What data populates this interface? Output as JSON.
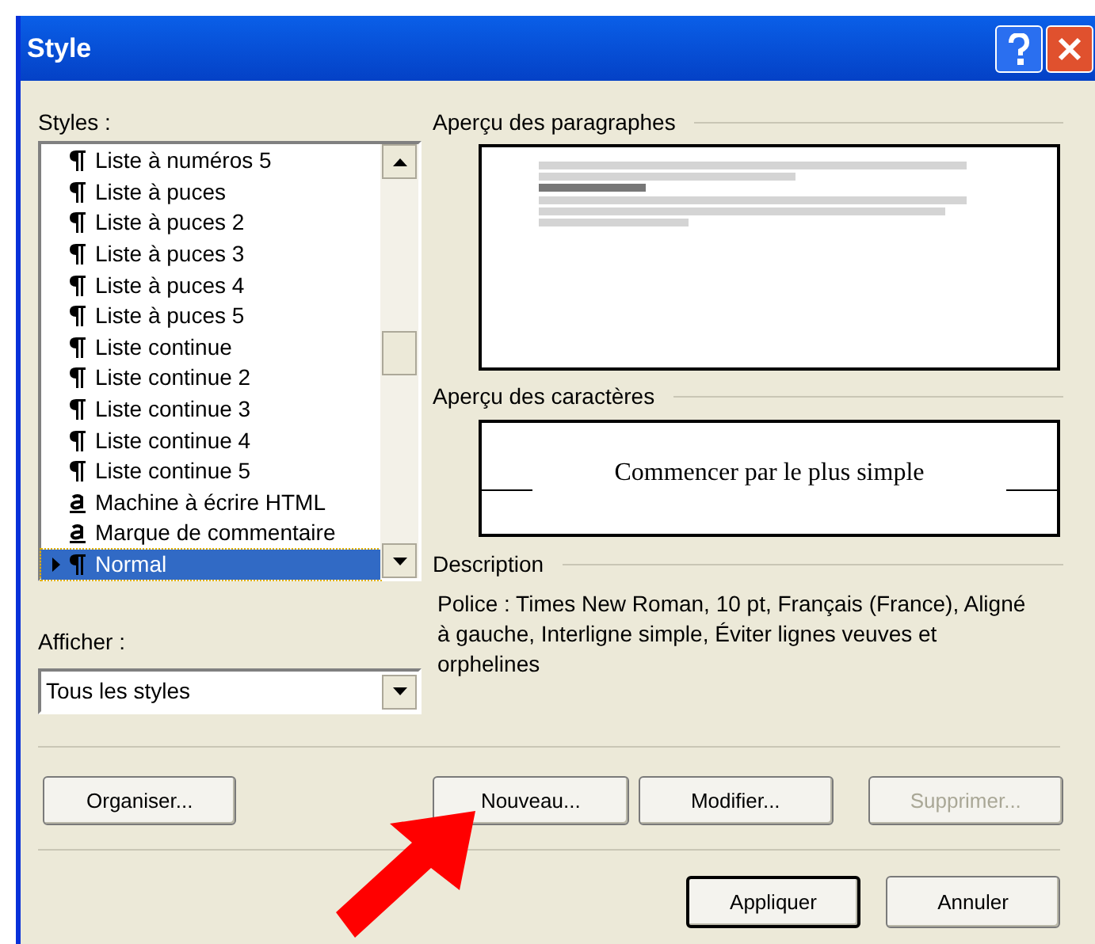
{
  "window": {
    "title": "Style"
  },
  "styles_label": "Styles :",
  "styles": [
    {
      "label": "Liste à numéros 5",
      "kind": "paragraph",
      "selected": false
    },
    {
      "label": "Liste à puces",
      "kind": "paragraph",
      "selected": false
    },
    {
      "label": "Liste à puces 2",
      "kind": "paragraph",
      "selected": false
    },
    {
      "label": "Liste à puces 3",
      "kind": "paragraph",
      "selected": false
    },
    {
      "label": "Liste à puces 4",
      "kind": "paragraph",
      "selected": false
    },
    {
      "label": "Liste à puces 5",
      "kind": "paragraph",
      "selected": false
    },
    {
      "label": "Liste continue",
      "kind": "paragraph",
      "selected": false
    },
    {
      "label": "Liste continue 2",
      "kind": "paragraph",
      "selected": false
    },
    {
      "label": "Liste continue 3",
      "kind": "paragraph",
      "selected": false
    },
    {
      "label": "Liste continue 4",
      "kind": "paragraph",
      "selected": false
    },
    {
      "label": "Liste continue 5",
      "kind": "paragraph",
      "selected": false
    },
    {
      "label": "Machine à écrire HTML",
      "kind": "character",
      "selected": false
    },
    {
      "label": "Marque de commentaire",
      "kind": "character",
      "selected": false
    },
    {
      "label": "Normal",
      "kind": "paragraph",
      "selected": true
    }
  ],
  "paragraph_preview_label": "Aperçu des paragraphes",
  "character_preview_label": "Aperçu des caractères",
  "character_preview_text": "Commencer par le plus simple",
  "description_label": "Description",
  "description": "Police : Times New Roman, 10 pt, Français (France), Aligné à gauche, Interligne simple, Éviter lignes veuves et orphelines",
  "show_label": "Afficher :",
  "show_value": "Tous les styles",
  "buttons": [
    {
      "label": "Organiser...",
      "disabled": false
    },
    {
      "label": "Nouveau...",
      "disabled": false
    },
    {
      "label": "Modifier...",
      "disabled": false
    },
    {
      "label": "Supprimer...",
      "disabled": true
    }
  ],
  "footer_buttons": [
    {
      "label": "Appliquer",
      "default": true
    },
    {
      "label": "Annuler",
      "default": false
    }
  ]
}
